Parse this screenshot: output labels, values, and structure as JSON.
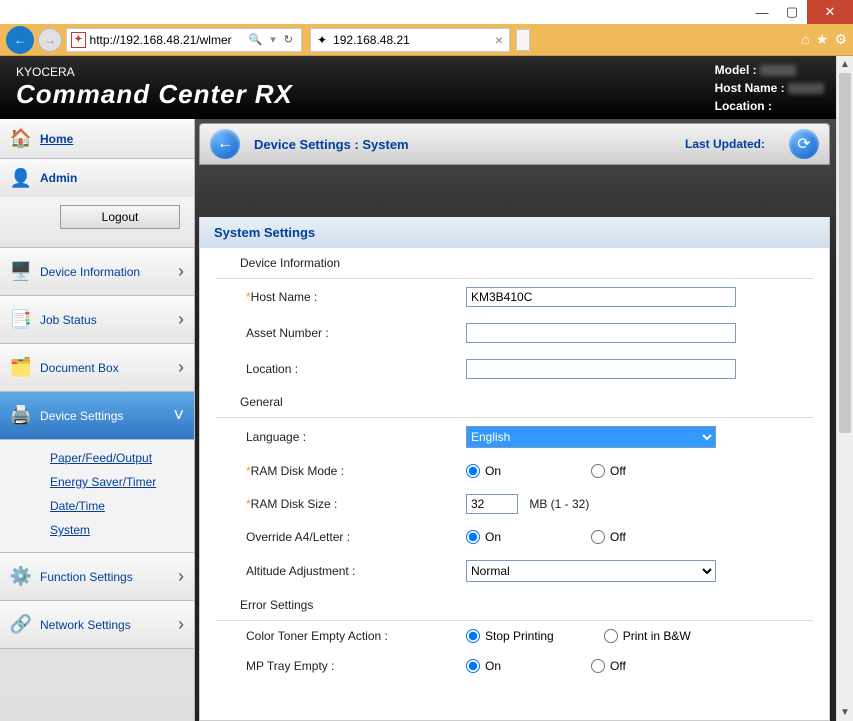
{
  "window": {
    "url": "http://192.168.48.21/wlmer",
    "tab_title": "192.168.48.21"
  },
  "banner": {
    "brand_top": "KYOCERA",
    "brand_main": "Command Center",
    "brand_rx": "RX",
    "model_label": "Model :",
    "hostname_label": "Host Name :",
    "location_label": "Location :"
  },
  "sidebar": {
    "home": "Home",
    "admin": "Admin",
    "logout": "Logout",
    "device_info": "Device Information",
    "job_status": "Job Status",
    "document_box": "Document Box",
    "device_settings": "Device Settings",
    "sub": {
      "paper": "Paper/Feed/Output",
      "energy": "Energy Saver/Timer",
      "datetime": "Date/Time",
      "system": "System"
    },
    "function_settings": "Function Settings",
    "network_settings": "Network Settings"
  },
  "toolbar": {
    "crumb": "Device Settings : System",
    "last_updated_label": "Last Updated:"
  },
  "form": {
    "section": "System Settings",
    "groups": {
      "devinfo": "Device Information",
      "general": "General",
      "error": "Error Settings"
    },
    "labels": {
      "hostname": "Host Name :",
      "asset": "Asset Number :",
      "location": "Location :",
      "language": "Language :",
      "ram_mode": "RAM Disk Mode :",
      "ram_size": "RAM Disk Size :",
      "ram_hint": "MB (1 - 32)",
      "override": "Override A4/Letter :",
      "altitude": "Altitude Adjustment :",
      "toner_empty": "Color Toner Empty Action :",
      "mp_tray": "MP Tray Empty :"
    },
    "values": {
      "hostname": "KM3B410C",
      "asset": "",
      "location": "",
      "language": "English",
      "ram_size": "32",
      "altitude": "Normal"
    },
    "radio": {
      "on": "On",
      "off": "Off",
      "stop": "Stop Printing",
      "bw": "Print in B&W"
    }
  }
}
